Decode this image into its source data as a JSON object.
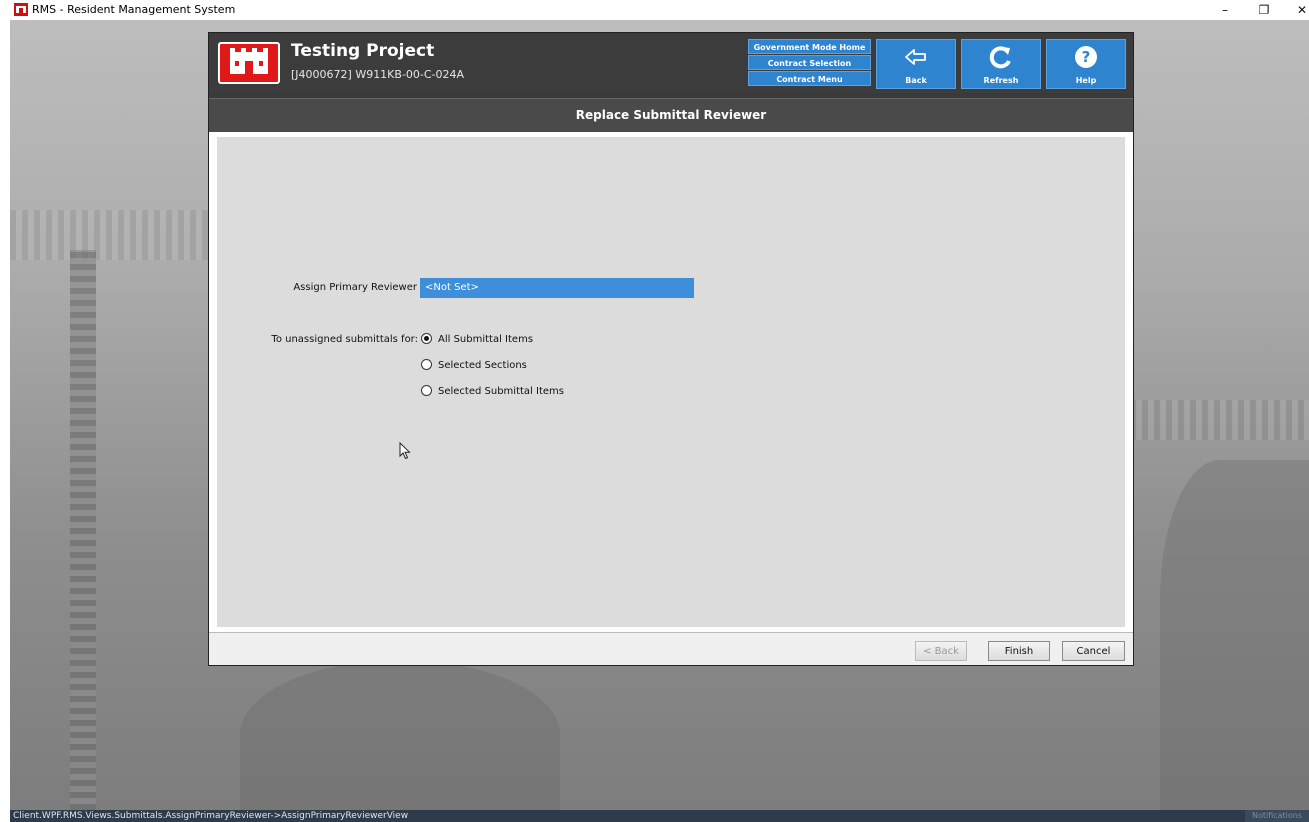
{
  "app": {
    "window_title": "RMS - Resident Management System"
  },
  "header": {
    "project_name": "Testing Project",
    "project_id": "[J4000672] W911KB-00-C-024A",
    "nav_links": [
      "Government Mode Home",
      "Contract Selection",
      "Contract Menu"
    ],
    "tiles": [
      {
        "label": "Back",
        "icon": "back-arrow-icon"
      },
      {
        "label": "Refresh",
        "icon": "refresh-icon"
      },
      {
        "label": "Help",
        "icon": "help-icon"
      }
    ]
  },
  "page": {
    "title": "Replace Submittal Reviewer"
  },
  "form": {
    "assign_label": "Assign Primary Reviewer",
    "assign_value": "<Not Set>",
    "unassigned_label": "To unassigned submittals for:",
    "options": [
      {
        "label": "All Submittal Items",
        "selected": true
      },
      {
        "label": "Selected Sections",
        "selected": false
      },
      {
        "label": "Selected Submittal Items",
        "selected": false
      }
    ]
  },
  "footer": {
    "back_label": "< Back",
    "finish_label": "Finish",
    "cancel_label": "Cancel"
  },
  "statusbar": {
    "view_path": "Client.WPF.RMS.Views.Submittals.AssignPrimaryReviewer->AssignPrimaryReviewerView",
    "notifications_label": "Notifications"
  },
  "colors": {
    "accent": "#2f84d0",
    "header_bg": "#3c3c3c",
    "logo_red": "#e01818"
  }
}
